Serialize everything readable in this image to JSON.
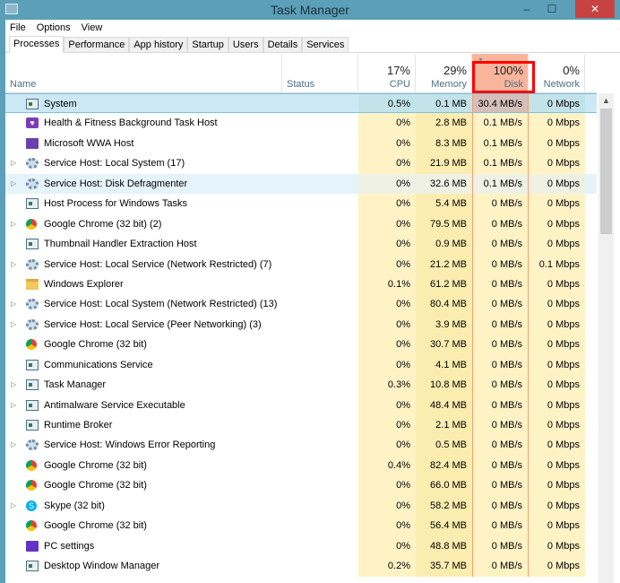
{
  "window": {
    "title": "Task Manager",
    "minimize": "‒",
    "maximize": "☐",
    "close": "✕"
  },
  "menu": [
    "File",
    "Options",
    "View"
  ],
  "tabs": [
    "Processes",
    "Performance",
    "App history",
    "Startup",
    "Users",
    "Details",
    "Services"
  ],
  "columns": {
    "name": "Name",
    "status": "Status",
    "cpu": {
      "pct": "17%",
      "label": "CPU"
    },
    "memory": {
      "pct": "29%",
      "label": "Memory"
    },
    "disk": {
      "pct": "100%",
      "label": "Disk"
    },
    "network": {
      "pct": "0%",
      "label": "Network"
    }
  },
  "highlight_color": "#ff0000",
  "rows": [
    {
      "name": "System",
      "icon": "window",
      "exp": false,
      "cpu": "0.5%",
      "mem": "0.1 MB",
      "disk": "30.4 MB/s",
      "net": "0 Mbps"
    },
    {
      "name": "Health & Fitness Background Task Host",
      "icon": "heart",
      "exp": false,
      "cpu": "0%",
      "mem": "2.8 MB",
      "disk": "0.1 MB/s",
      "net": "0 Mbps"
    },
    {
      "name": "Microsoft WWA Host",
      "icon": "app",
      "exp": false,
      "cpu": "0%",
      "mem": "8.3 MB",
      "disk": "0.1 MB/s",
      "net": "0 Mbps"
    },
    {
      "name": "Service Host: Local System (17)",
      "icon": "gear",
      "exp": true,
      "cpu": "0%",
      "mem": "21.9 MB",
      "disk": "0.1 MB/s",
      "net": "0 Mbps"
    },
    {
      "name": "Service Host: Disk Defragmenter",
      "icon": "gear",
      "exp": true,
      "cpu": "0%",
      "mem": "32.6 MB",
      "disk": "0.1 MB/s",
      "net": "0 Mbps"
    },
    {
      "name": "Host Process for Windows Tasks",
      "icon": "window",
      "exp": false,
      "cpu": "0%",
      "mem": "5.4 MB",
      "disk": "0 MB/s",
      "net": "0 Mbps"
    },
    {
      "name": "Google Chrome (32 bit) (2)",
      "icon": "chrome",
      "exp": true,
      "cpu": "0%",
      "mem": "79.5 MB",
      "disk": "0 MB/s",
      "net": "0 Mbps"
    },
    {
      "name": "Thumbnail Handler Extraction Host",
      "icon": "window",
      "exp": false,
      "cpu": "0%",
      "mem": "0.9 MB",
      "disk": "0 MB/s",
      "net": "0 Mbps"
    },
    {
      "name": "Service Host: Local Service (Network Restricted) (7)",
      "icon": "gear",
      "exp": true,
      "cpu": "0%",
      "mem": "21.2 MB",
      "disk": "0 MB/s",
      "net": "0.1 Mbps"
    },
    {
      "name": "Windows Explorer",
      "icon": "folder",
      "exp": false,
      "cpu": "0.1%",
      "mem": "61.2 MB",
      "disk": "0 MB/s",
      "net": "0 Mbps"
    },
    {
      "name": "Service Host: Local System (Network Restricted) (13)",
      "icon": "gear",
      "exp": true,
      "cpu": "0%",
      "mem": "80.4 MB",
      "disk": "0 MB/s",
      "net": "0 Mbps"
    },
    {
      "name": "Service Host: Local Service (Peer Networking) (3)",
      "icon": "gear",
      "exp": true,
      "cpu": "0%",
      "mem": "3.9 MB",
      "disk": "0 MB/s",
      "net": "0 Mbps"
    },
    {
      "name": "Google Chrome (32 bit)",
      "icon": "chrome",
      "exp": false,
      "cpu": "0%",
      "mem": "30.7 MB",
      "disk": "0 MB/s",
      "net": "0 Mbps"
    },
    {
      "name": "Communications Service",
      "icon": "window",
      "exp": false,
      "cpu": "0%",
      "mem": "4.1 MB",
      "disk": "0 MB/s",
      "net": "0 Mbps"
    },
    {
      "name": "Task Manager",
      "icon": "window",
      "exp": true,
      "cpu": "0.3%",
      "mem": "10.8 MB",
      "disk": "0 MB/s",
      "net": "0 Mbps"
    },
    {
      "name": "Antimalware Service Executable",
      "icon": "window",
      "exp": true,
      "cpu": "0%",
      "mem": "48.4 MB",
      "disk": "0 MB/s",
      "net": "0 Mbps"
    },
    {
      "name": "Runtime Broker",
      "icon": "window",
      "exp": false,
      "cpu": "0%",
      "mem": "2.1 MB",
      "disk": "0 MB/s",
      "net": "0 Mbps"
    },
    {
      "name": "Service Host: Windows Error Reporting",
      "icon": "gear",
      "exp": true,
      "cpu": "0%",
      "mem": "0.5 MB",
      "disk": "0 MB/s",
      "net": "0 Mbps"
    },
    {
      "name": "Google Chrome (32 bit)",
      "icon": "chrome",
      "exp": false,
      "cpu": "0.4%",
      "mem": "82.4 MB",
      "disk": "0 MB/s",
      "net": "0 Mbps"
    },
    {
      "name": "Google Chrome (32 bit)",
      "icon": "chrome",
      "exp": false,
      "cpu": "0%",
      "mem": "66.0 MB",
      "disk": "0 MB/s",
      "net": "0 Mbps"
    },
    {
      "name": "Skype (32 bit)",
      "icon": "skype",
      "exp": true,
      "cpu": "0%",
      "mem": "58.2 MB",
      "disk": "0 MB/s",
      "net": "0 Mbps"
    },
    {
      "name": "Google Chrome (32 bit)",
      "icon": "chrome",
      "exp": false,
      "cpu": "0%",
      "mem": "56.4 MB",
      "disk": "0 MB/s",
      "net": "0 Mbps"
    },
    {
      "name": "PC settings",
      "icon": "settings",
      "exp": false,
      "cpu": "0%",
      "mem": "48.8 MB",
      "disk": "0 MB/s",
      "net": "0 Mbps"
    },
    {
      "name": "Desktop Window Manager",
      "icon": "window",
      "exp": false,
      "cpu": "0.2%",
      "mem": "35.7 MB",
      "disk": "0 MB/s",
      "net": "0 Mbps"
    }
  ]
}
